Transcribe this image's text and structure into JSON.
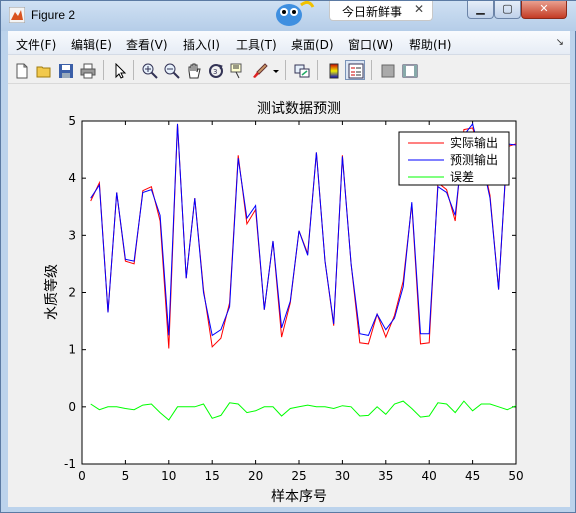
{
  "window": {
    "title": "Figure 2",
    "news_tab": "今日新鲜事",
    "close_label": "✕",
    "min_label": "▁",
    "max_label": "▢"
  },
  "menu": {
    "items": [
      "文件(F)",
      "编辑(E)",
      "查看(V)",
      "插入(I)",
      "工具(T)",
      "桌面(D)",
      "窗口(W)",
      "帮助(H)"
    ],
    "overflow": "↘"
  },
  "toolbar": {
    "icons": [
      "new-figure-icon",
      "open-file-icon",
      "save-icon",
      "print-icon",
      "pointer-icon",
      "zoom-in-icon",
      "zoom-out-icon",
      "pan-icon",
      "rotate-3d-icon",
      "data-cursor-icon",
      "brush-icon",
      "link-plot-icon",
      "colorbar-icon",
      "legend-icon",
      "hide-plot-tools-icon",
      "show-plot-tools-icon"
    ]
  },
  "colors": {
    "actual": "#ff0000",
    "predicted": "#0000ff",
    "error": "#00ff00"
  },
  "chart_data": {
    "type": "line",
    "title": "测试数据预测",
    "xlabel": "样本序号",
    "ylabel": "水质等级",
    "xlim": [
      0,
      50
    ],
    "ylim": [
      -1,
      5
    ],
    "xticks": [
      "0",
      "5",
      "10",
      "15",
      "20",
      "25",
      "30",
      "35",
      "40",
      "45",
      "50"
    ],
    "yticks": [
      "-1",
      "0",
      "1",
      "2",
      "3",
      "4",
      "5"
    ],
    "legend_position": "top-right",
    "grid": false,
    "x": [
      1,
      2,
      3,
      4,
      5,
      6,
      7,
      8,
      9,
      10,
      11,
      12,
      13,
      14,
      15,
      16,
      17,
      18,
      19,
      20,
      21,
      22,
      23,
      24,
      25,
      26,
      27,
      28,
      29,
      30,
      31,
      32,
      33,
      34,
      35,
      36,
      37,
      38,
      39,
      40,
      41,
      42,
      43,
      44,
      45,
      46,
      47,
      48,
      49,
      50
    ],
    "series": [
      {
        "name": "实际输出",
        "color": "#ff0000",
        "values": [
          3.6,
          3.92,
          1.65,
          3.75,
          2.55,
          2.5,
          3.78,
          3.85,
          3.25,
          1.02,
          4.95,
          2.25,
          3.65,
          2.05,
          1.05,
          1.2,
          1.82,
          4.4,
          3.2,
          3.45,
          1.7,
          2.9,
          1.22,
          1.82,
          3.08,
          2.68,
          4.45,
          2.55,
          1.42,
          4.4,
          2.5,
          1.12,
          1.1,
          1.62,
          1.22,
          1.6,
          2.2,
          3.55,
          1.1,
          1.12,
          3.92,
          3.8,
          3.25,
          4.85,
          4.88,
          4.4,
          3.7,
          2.05,
          4.55,
          4.6
        ]
      },
      {
        "name": "预测输出",
        "color": "#0000ff",
        "values": [
          3.65,
          3.88,
          1.65,
          3.75,
          2.58,
          2.55,
          3.75,
          3.8,
          3.35,
          1.25,
          4.95,
          2.25,
          3.65,
          2.0,
          1.25,
          1.35,
          1.75,
          4.35,
          3.3,
          3.52,
          1.7,
          2.9,
          1.38,
          1.85,
          3.08,
          2.65,
          4.45,
          2.55,
          1.45,
          4.38,
          2.5,
          1.28,
          1.25,
          1.62,
          1.35,
          1.55,
          2.1,
          3.58,
          1.28,
          1.28,
          3.85,
          3.75,
          3.35,
          4.75,
          4.95,
          4.35,
          3.65,
          2.05,
          4.6,
          4.58
        ]
      },
      {
        "name": "误差",
        "color": "#00ff00",
        "values": [
          0.05,
          -0.05,
          0.0,
          0.0,
          -0.03,
          -0.05,
          0.03,
          0.05,
          -0.1,
          -0.23,
          0.0,
          0.0,
          0.0,
          0.05,
          -0.2,
          -0.15,
          0.07,
          0.05,
          -0.1,
          -0.07,
          0.0,
          0.0,
          -0.16,
          -0.03,
          0.0,
          0.03,
          0.0,
          0.0,
          -0.03,
          0.02,
          0.0,
          -0.16,
          -0.15,
          0.0,
          -0.13,
          0.05,
          0.1,
          -0.03,
          -0.18,
          -0.16,
          0.07,
          0.05,
          -0.1,
          0.1,
          -0.07,
          0.05,
          0.05,
          0.0,
          -0.05,
          0.02
        ]
      }
    ]
  }
}
